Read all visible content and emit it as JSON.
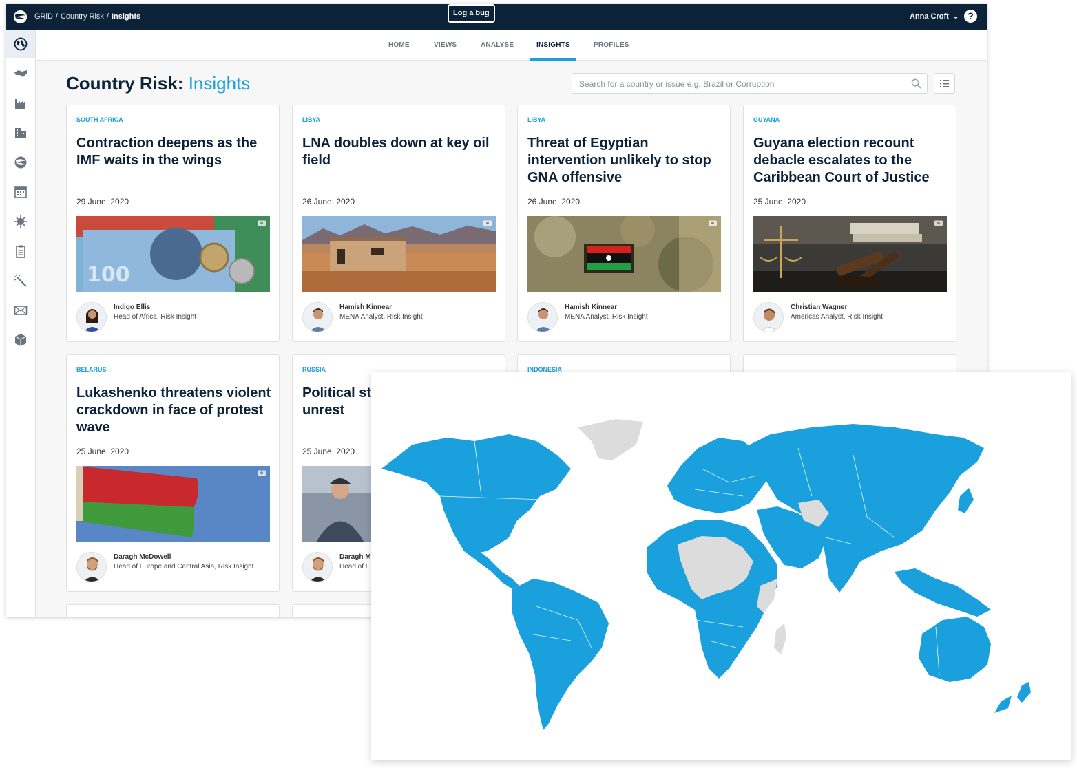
{
  "topbar": {
    "breadcrumbs": [
      "GRiD",
      "Country Risk",
      "Insights"
    ],
    "bug_button": "Log a bug",
    "user_name": "Anna Croft",
    "help_label": "?"
  },
  "sidebar": {
    "icons": [
      "globe-icon",
      "handshake-icon",
      "factory-icon",
      "buildings-icon",
      "grid-logo-icon",
      "calendar-icon",
      "virus-icon",
      "clipboard-icon",
      "magic-wand-icon",
      "envelope-icon",
      "cube-icon"
    ]
  },
  "tabs": [
    "HOME",
    "VIEWS",
    "ANALYSE",
    "INSIGHTS",
    "PROFILES"
  ],
  "active_tab": "INSIGHTS",
  "page": {
    "title_main": "Country Risk:",
    "title_accent": "Insights",
    "search_placeholder": "Search for a country or issue e.g. Brazil or Corruption"
  },
  "cards": [
    {
      "country": "SOUTH AFRICA",
      "title": "Contraction deepens as the IMF waits in the wings",
      "date": "29 June, 2020",
      "author": "Indigo Ellis",
      "role": "Head of Africa, Risk Insight"
    },
    {
      "country": "LIBYA",
      "title": "LNA doubles down at key oil field",
      "date": "26 June, 2020",
      "author": "Hamish Kinnear",
      "role": "MENA Analyst, Risk Insight"
    },
    {
      "country": "LIBYA",
      "title": "Threat of Egyptian intervention unlikely to stop GNA offensive",
      "date": "26 June, 2020",
      "author": "Hamish Kinnear",
      "role": "MENA Analyst, Risk Insight"
    },
    {
      "country": "GUYANA",
      "title": "Guyana election recount debacle escalates to the Caribbean Court of Justice",
      "date": "25 June, 2020",
      "author": "Christian Wagner",
      "role": "Americas Analyst, Risk Insight"
    },
    {
      "country": "BELARUS",
      "title": "Lukashenko threatens violent crackdown in face of protest wave",
      "date": "25 June, 2020",
      "author": "Daragh McDowell",
      "role": "Head of Europe and Central Asia, Risk Insight"
    },
    {
      "country": "RUSSIA",
      "title": "Political st Russia reo civil unrest",
      "date": "25 June, 2020",
      "author": "Daragh M",
      "role": "Head of E"
    },
    {
      "country": "INDONESIA"
    }
  ],
  "colors": {
    "navy": "#0b2239",
    "accent": "#1aa0dc",
    "map_fill": "#1aa0dc",
    "map_other": "#dcdcdc"
  }
}
